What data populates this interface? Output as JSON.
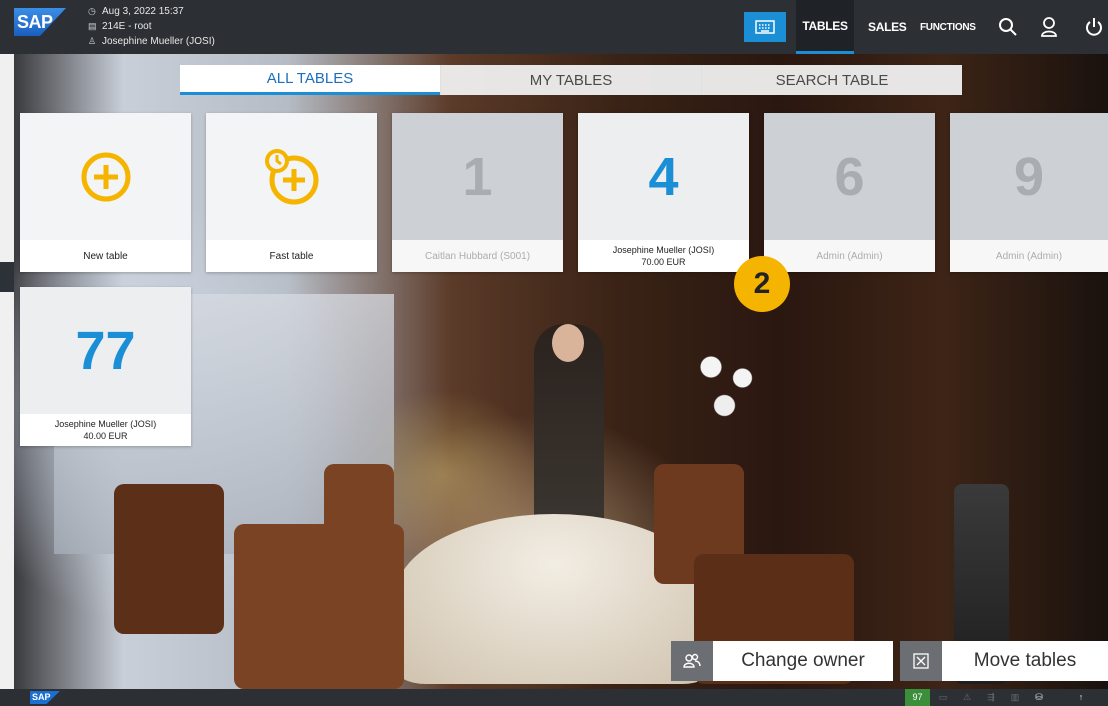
{
  "header": {
    "logo_text": "SAP",
    "datetime": "Aug 3, 2022 15:37",
    "device": "214E - root",
    "user": "Josephine Mueller (JOSI)",
    "nav": {
      "tables": "TABLES",
      "sales": "SALES",
      "functions": "FUNCTIONS"
    },
    "accent_color": "#1b8fd6"
  },
  "tabs": [
    {
      "label": "ALL TABLES",
      "active": true
    },
    {
      "label": "MY TABLES",
      "active": false
    },
    {
      "label": "SEARCH TABLE",
      "active": false
    }
  ],
  "tiles": [
    {
      "icon": "plus-circle-icon",
      "label": "New table"
    },
    {
      "icon": "fast-table-icon",
      "label": "Fast table"
    },
    {
      "number": "1",
      "label": "Caitlan Hubbard (S001)"
    },
    {
      "number": "4",
      "label": "Josephine Mueller (JOSI)",
      "amount": "70.00 EUR"
    },
    {
      "number": "6",
      "label": "Admin (Admin)"
    },
    {
      "number": "9",
      "label": "Admin (Admin)"
    },
    {
      "number": "77",
      "label": "Josephine Mueller (JOSI)",
      "amount": "40.00 EUR"
    }
  ],
  "badge": "2",
  "actions": {
    "change_owner": "Change owner",
    "move_tables": "Move tables"
  },
  "footer": {
    "logo_text": "SAP",
    "count": "97"
  }
}
